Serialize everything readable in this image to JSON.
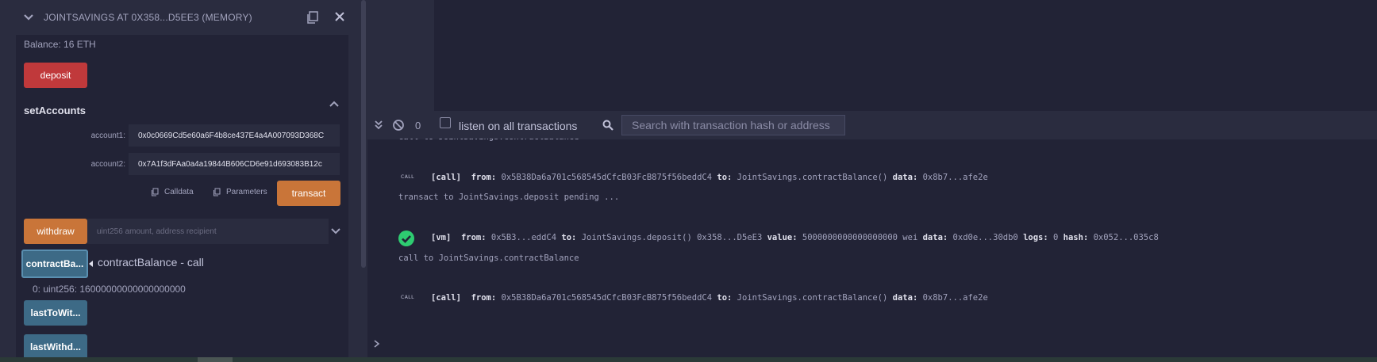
{
  "contract": {
    "title": "JOINTSAVINGS AT 0X358...D5EE3 (MEMORY)",
    "balance": "Balance: 16 ETH"
  },
  "buttons": {
    "deposit": "deposit",
    "transact": "transact",
    "withdraw": "withdraw",
    "contract_balance": "contractBa...",
    "last_to_withdraw": "lastToWit...",
    "last_withdraw": "lastWithd..."
  },
  "set_accounts": {
    "title": "setAccounts",
    "account1_label": "account1:",
    "account1_value": "0x0c0669Cd5e60a6F4b8ce437E4a4A007093D368C",
    "account2_label": "account2:",
    "account2_value": "0x7A1f3dFAa0a4a19844B606CD6e91d693083B12c",
    "calldata": "Calldata",
    "parameters": "Parameters"
  },
  "withdraw": {
    "placeholder": "uint256 amount, address recipient"
  },
  "contract_balance": {
    "call_label": "contractBalance - call",
    "result": "0: uint256: 16000000000000000000"
  },
  "terminal": {
    "pending_count": "0",
    "listen_label": "listen on all transactions",
    "search_placeholder": "Search with transaction hash or address",
    "cut_line": "call to JointSavings.contractBalance",
    "call_badge": "CALL",
    "log1": {
      "tag": "[call]",
      "from_label": "from:",
      "from": "0x5B38Da6a701c568545dCfcB03FcB875f56beddC4",
      "to_label": "to:",
      "to": "JointSavings.contractBalance()",
      "data_label": "data:",
      "data": "0x8b7...afe2e"
    },
    "log2": "transact to JointSavings.deposit pending ...",
    "log3": {
      "tag": "[vm]",
      "from_label": "from:",
      "from": "0x5B3...eddC4",
      "to_label": "to:",
      "to": "JointSavings.deposit() 0x358...D5eE3",
      "value_label": "value:",
      "value": "5000000000000000000 wei",
      "data_label": "data:",
      "data": "0xd0e...30db0",
      "logs_label": "logs:",
      "logs": "0",
      "hash_label": "hash:",
      "hash": "0x052...035c8"
    },
    "log4": "call to JointSavings.contractBalance",
    "log5": {
      "tag": "[call]",
      "from_label": "from:",
      "from": "0x5B38Da6a701c568545dCfcB03FcB875f56beddC4",
      "to_label": "to:",
      "to": "JointSavings.contractBalance()",
      "data_label": "data:",
      "data": "0x8b7...afe2e"
    }
  },
  "colors": {
    "deposit": "#c0393b",
    "transact": "#c97539",
    "call_button": "#3d6a86",
    "success": "#2ecc71"
  }
}
